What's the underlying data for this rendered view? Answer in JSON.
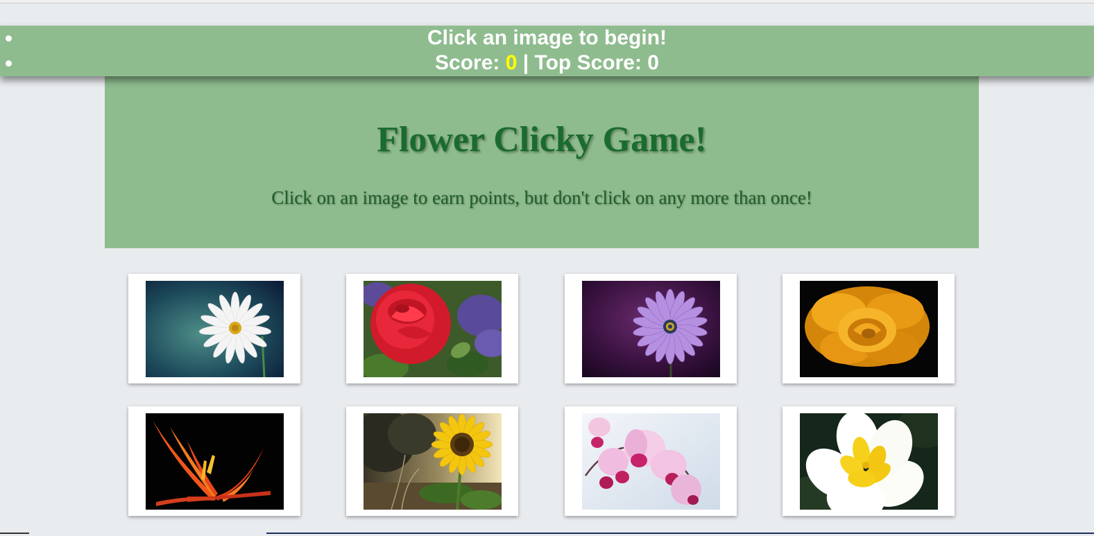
{
  "nav": {
    "status": "Click an image to begin!",
    "score_label": "Score: ",
    "score": "0",
    "separator": " | ",
    "top_score_label": "Top Score: ",
    "top_score": "0"
  },
  "header": {
    "title": "Flower Clicky Game!",
    "subtitle": "Click on an image to earn points, but don't click on any more than once!"
  },
  "colors": {
    "navbar": "#8fbc8f",
    "jumbotron": "#8fbc8f",
    "title": "#1a6b2e",
    "score_highlight": "#ffff00",
    "page_bg": "#e9ecef"
  },
  "cards": [
    {
      "name": "white-daisy"
    },
    {
      "name": "red-rose"
    },
    {
      "name": "purple-daisy"
    },
    {
      "name": "yellow-rose"
    },
    {
      "name": "bird-of-paradise"
    },
    {
      "name": "sunflower"
    },
    {
      "name": "pink-orchid"
    },
    {
      "name": "plumeria"
    }
  ]
}
